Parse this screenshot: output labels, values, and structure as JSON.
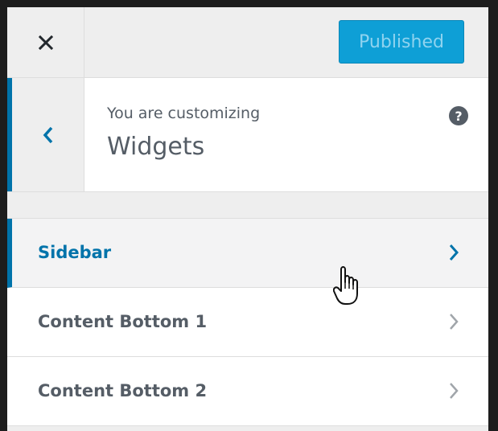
{
  "header": {
    "close_label": "Close",
    "publish_label": "Published"
  },
  "section": {
    "back_label": "Back",
    "customizing_label": "You are customizing",
    "title": "Widgets",
    "help_label": "?"
  },
  "menu": {
    "items": [
      {
        "label": "Sidebar",
        "active": true
      },
      {
        "label": "Content Bottom 1",
        "active": false
      },
      {
        "label": "Content Bottom 2",
        "active": false
      }
    ]
  },
  "colors": {
    "accent": "#0073aa",
    "publish_bg": "#0e9fd6",
    "text": "#555d66",
    "panel_bg": "#eeeeee"
  },
  "icons": {
    "close": "close-icon",
    "back": "chevron-left-icon",
    "help": "question-circle-icon",
    "item": "chevron-right-icon",
    "cursor": "hand-pointer-icon"
  }
}
